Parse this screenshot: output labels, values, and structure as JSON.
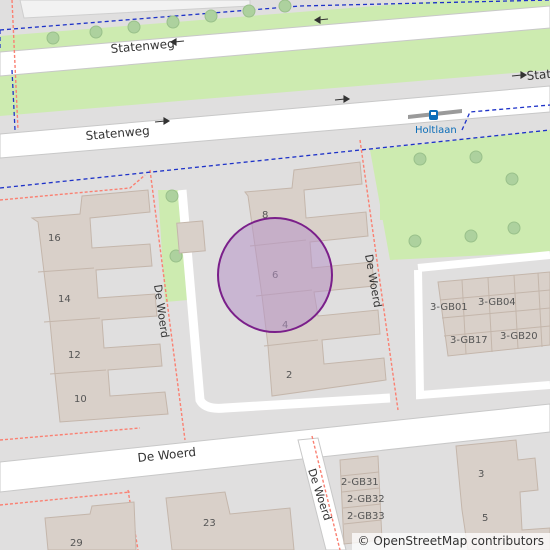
{
  "map": {
    "streets": {
      "statenweg_1": "Statenweg",
      "statenweg_2": "Statenweg",
      "statenweg_3": "State",
      "de_woerd_1": "De Woerd",
      "de_woerd_2": "De Woerd",
      "de_woerd_3": "De Woerd",
      "de_woerd_4": "De Woerd"
    },
    "bus_stop": "Holtlaan",
    "house_numbers": {
      "n16": "16",
      "n14": "14",
      "n12": "12",
      "n10": "10",
      "n8": "8",
      "n6": "6",
      "n4": "4",
      "n2": "2",
      "n3": "3",
      "n5": "5",
      "n23": "23",
      "n29": "29",
      "gb01": "3-GB01",
      "gb04": "3-GB04",
      "gb17": "3-GB17",
      "gb20": "3-GB20",
      "gb31": "2-GB31",
      "gb32": "2-GB32",
      "gb33": "2-GB33"
    },
    "attribution": {
      "symbol": "©",
      "text": "OpenStreetMap contributors"
    },
    "colors": {
      "background": "#e0dfdf",
      "road": "#ffffff",
      "grass": "#cdebb0",
      "building": "#d9d0c9",
      "building_stroke": "#c4b6ab",
      "tree": "#add19e",
      "boundary": "#1e32c8",
      "footway": "#fa8072",
      "marker_fill": "#b794c7",
      "marker_stroke": "#7a1f8a"
    }
  }
}
